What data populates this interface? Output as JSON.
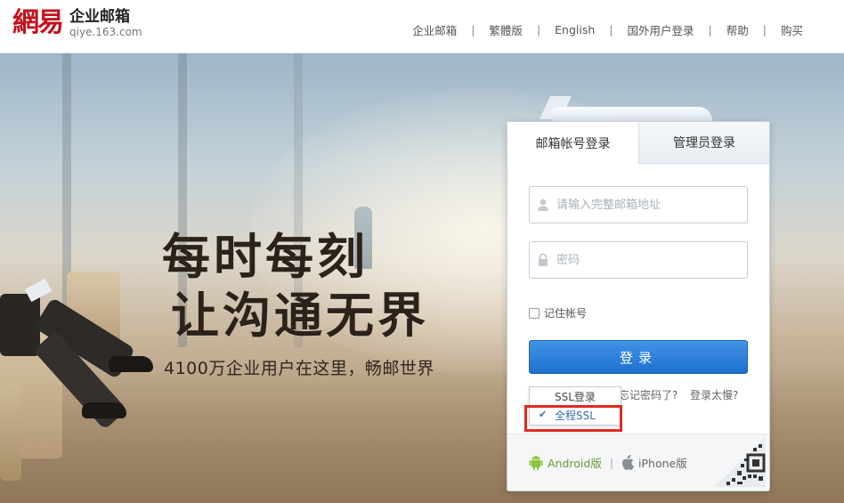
{
  "header": {
    "logo_mark": "網易",
    "logo_title": "企业邮箱",
    "logo_sub": "qiye.163.com",
    "nav": [
      {
        "label": "企业邮箱"
      },
      {
        "label": "繁體版"
      },
      {
        "label": "English"
      },
      {
        "label": "国外用户登录"
      },
      {
        "label": "帮助"
      },
      {
        "label": "购买"
      }
    ],
    "separator": "|"
  },
  "hero": {
    "slogan_line1": "每时每刻",
    "slogan_line2": "让沟通无界",
    "tagline": "4100万企业用户在这里，畅邮世界"
  },
  "login": {
    "tabs": [
      {
        "label": "邮箱帐号登录",
        "active": true
      },
      {
        "label": "管理员登录",
        "active": false
      }
    ],
    "email_placeholder": "请输入完整邮箱地址",
    "password_placeholder": "密码",
    "remember_label": "记住帐号",
    "submit_label": "登录",
    "ssl_options": [
      {
        "label": "SSL登录",
        "selected": false
      },
      {
        "label": "全程SSL",
        "selected": true
      }
    ],
    "forgot_label": "忘记密码了?",
    "slow_label": "登录太慢?",
    "apps": {
      "android_label": "Android版",
      "iphone_label": "iPhone版",
      "separator": "|"
    }
  },
  "colors": {
    "brand_red": "#c4111b",
    "button_blue": "#1c70cf",
    "highlight_red": "#e02a1f",
    "android_green": "#8ac33e"
  }
}
